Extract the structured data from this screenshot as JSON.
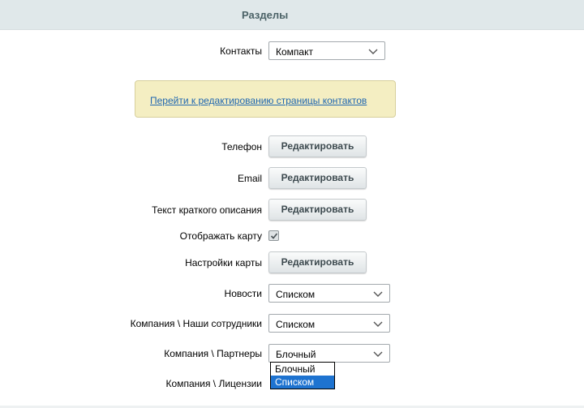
{
  "header": {
    "title": "Разделы"
  },
  "contacts": {
    "label": "Контакты",
    "value": "Компакт"
  },
  "notice": {
    "link": "Перейти к редактированию страницы контактов"
  },
  "phone": {
    "label": "Телефон",
    "button": "Редактировать"
  },
  "email": {
    "label": "Email",
    "button": "Редактировать"
  },
  "short_desc": {
    "label": "Текст краткого описания",
    "button": "Редактировать"
  },
  "show_map": {
    "label": "Отображать карту",
    "checked": true
  },
  "map_settings": {
    "label": "Настройки карты",
    "button": "Редактировать"
  },
  "news": {
    "label": "Новости",
    "value": "Списком"
  },
  "staff": {
    "label": "Компания \\ Наши сотрудники",
    "value": "Списком"
  },
  "partners": {
    "label": "Компания \\ Партнеры",
    "value": "Блочный",
    "options": [
      "Блочный",
      "Списком"
    ],
    "highlighted": "Списком"
  },
  "licenses": {
    "label": "Компания \\ Лицензии"
  },
  "icons": {
    "chevron": "chevron-down-icon",
    "check": "check-icon"
  },
  "colors": {
    "accent": "#1e73d0",
    "link": "#2067b0",
    "notice_bg": "#f4eec2"
  }
}
